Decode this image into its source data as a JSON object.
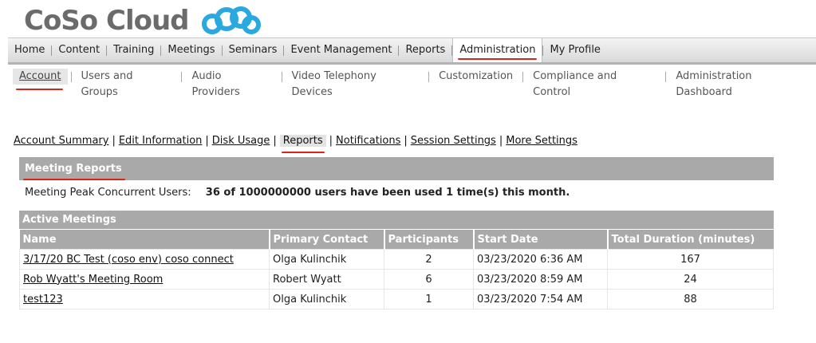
{
  "brand": {
    "name": "CoSo Cloud",
    "mark_color": "#29a9df"
  },
  "main_nav": [
    {
      "label": "Home",
      "active": false
    },
    {
      "label": "Content",
      "active": false
    },
    {
      "label": "Training",
      "active": false
    },
    {
      "label": "Meetings",
      "active": false
    },
    {
      "label": "Seminars",
      "active": false
    },
    {
      "label": "Event Management",
      "active": false
    },
    {
      "label": "Reports",
      "active": false
    },
    {
      "label": "Administration",
      "active": true
    },
    {
      "label": "My Profile",
      "active": false
    }
  ],
  "sub_nav": [
    {
      "label": "Account",
      "active": true
    },
    {
      "label": "Users and Groups",
      "active": false
    },
    {
      "label": "Audio Providers",
      "active": false
    },
    {
      "label": "Video Telephony Devices",
      "active": false
    },
    {
      "label": "Customization",
      "active": false
    },
    {
      "label": "Compliance and Control",
      "active": false
    },
    {
      "label": "Administration Dashboard",
      "active": false
    }
  ],
  "account_links": [
    {
      "label": "Account Summary",
      "active": false
    },
    {
      "label": "Edit Information",
      "active": false
    },
    {
      "label": "Disk Usage",
      "active": false
    },
    {
      "label": "Reports",
      "active": true
    },
    {
      "label": "Notifications",
      "active": false
    },
    {
      "label": "Session Settings",
      "active": false
    },
    {
      "label": "More Settings",
      "active": false
    }
  ],
  "meeting_reports": {
    "title": "Meeting Reports",
    "peak_label": "Meeting Peak Concurrent Users:",
    "peak_value": "36 of 1000000000 users have been used 1 time(s) this month."
  },
  "active_meetings": {
    "title": "Active Meetings",
    "columns": [
      "Name",
      "Primary Contact",
      "Participants",
      "Start Date",
      "Total Duration (minutes)"
    ],
    "rows": [
      {
        "name": "3/17/20 BC Test (coso env) coso connect",
        "contact": "Olga Kulinchik",
        "participants": "2",
        "start": "03/23/2020 6:36 AM",
        "duration": "167"
      },
      {
        "name": "Rob Wyatt's Meeting Room",
        "contact": "Robert Wyatt",
        "participants": "6",
        "start": "03/23/2020 8:59 AM",
        "duration": "24"
      },
      {
        "name": "test123",
        "contact": "Olga Kulinchik",
        "participants": "1",
        "start": "03/23/2020 7:54 AM",
        "duration": "88"
      }
    ]
  },
  "colors": {
    "accent_underline": "#d9261c",
    "header_bar": "#a9a9a9"
  }
}
